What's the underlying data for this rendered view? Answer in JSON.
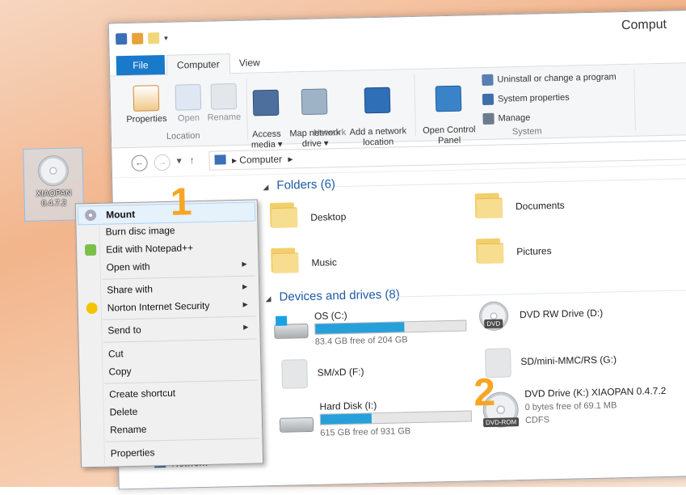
{
  "window": {
    "title": "Comput",
    "tabs": [
      "File",
      "Computer",
      "View"
    ],
    "ribbon": {
      "location": {
        "group_label": "Location",
        "buttons": [
          "Properties",
          "Open",
          "Rename"
        ]
      },
      "network": {
        "group_label": "Network",
        "buttons": [
          "Access\nmedia ▾",
          "Map network\ndrive ▾",
          "Add a network\nlocation"
        ]
      },
      "system": {
        "group_label": "System",
        "open_control_panel": "Open Control\nPanel",
        "items": [
          "Uninstall or change a program",
          "System properties",
          "Manage"
        ]
      }
    },
    "address": {
      "crumb": "Computer",
      "sep": "▸"
    },
    "nav_pane": {
      "network": "Network"
    }
  },
  "folders": {
    "header": "Folders (6)",
    "items": [
      "Desktop",
      "Documents",
      "Music",
      "Pictures"
    ]
  },
  "devices": {
    "header": "Devices and drives (8)",
    "os": {
      "name": "OS (C:)",
      "free": "83.4 GB free of 204 GB",
      "used_fraction": 0.59
    },
    "dvdrw": {
      "name": "DVD RW Drive (D:)",
      "badge": "DVD"
    },
    "smxd": {
      "name": "SM/xD (F:)"
    },
    "sdmmc": {
      "name": "SD/mini-MMC/RS (G:)"
    },
    "hdd": {
      "name": "Hard Disk (I:)",
      "free": "615 GB free of 931 GB",
      "used_fraction": 0.34
    },
    "dvd": {
      "name": "DVD Drive (K:) XIAOPAN 0.4.7.2",
      "free": "0 bytes free of 69.1 MB",
      "fs": "CDFS",
      "badge": "DVD-ROM"
    }
  },
  "desktop_icon": {
    "label": "XIAOPAN\n0.4.7.2"
  },
  "context_menu": {
    "items": [
      "Mount",
      "Burn disc image",
      "Edit with Notepad++",
      "Open with",
      "Share with",
      "Norton Internet Security",
      "Send to",
      "Cut",
      "Copy",
      "Create shortcut",
      "Delete",
      "Rename",
      "Properties"
    ],
    "submenu_arrow": "▶"
  },
  "annotations": [
    "1",
    "2"
  ],
  "colors": {
    "accent": "#1979ca",
    "progress": "#26a0da",
    "annotation": "#f6a623"
  }
}
